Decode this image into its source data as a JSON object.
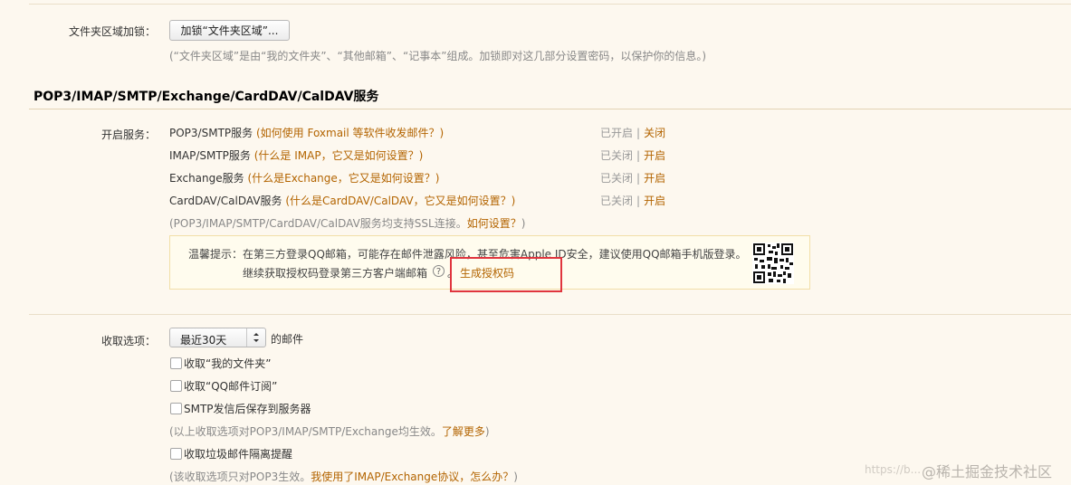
{
  "folder_lock": {
    "label": "文件夹区域加锁：",
    "button": "加锁“文件夹区域”...",
    "note": "(“文件夹区域”是由“我的文件夹”、“其他邮箱”、“记事本”组成。加锁即对这几部分设置密码，以保护你的信息。)"
  },
  "section": {
    "title": "POP3/IMAP/SMTP/Exchange/CardDAV/CalDAV服务"
  },
  "services": {
    "label": "开启服务：",
    "items": [
      {
        "name": "POP3/SMTP服务",
        "help": "(如何使用 Foxmail 等软件收发邮件？)",
        "status": "已开启",
        "sep": "|",
        "action": "关闭"
      },
      {
        "name": "IMAP/SMTP服务",
        "help": "(什么是 IMAP，它又是如何设置？)",
        "status": "已关闭",
        "sep": "|",
        "action": "开启"
      },
      {
        "name": "Exchange服务",
        "help": "(什么是Exchange，它又是如何设置？)",
        "status": "已关闭",
        "sep": "|",
        "action": "开启"
      },
      {
        "name": "CardDAV/CalDAV服务",
        "help": "(什么是CardDAV/CalDAV，它又是如何设置？)",
        "status": "已关闭",
        "sep": "|",
        "action": "开启"
      }
    ],
    "ssl_note": "(POP3/IMAP/SMTP/CardDAV/CalDAV服务均支持SSL连接。",
    "ssl_link": "如何设置？",
    "ssl_end": ")"
  },
  "tip": {
    "line1": "温馨提示：在第三方登录QQ邮箱，可能存在邮件泄露风险，甚至危害Apple ID安全，建议使用QQ邮箱手机版登录。",
    "line2": "继续获取授权码登录第三方客户端邮箱",
    "help": "?",
    "period": "。",
    "generate": "生成授权码"
  },
  "fetch": {
    "label": "收取选项：",
    "select_value": "最近30天",
    "select_suffix": "的邮件",
    "opt1": "收取“我的文件夹”",
    "opt2": "收取“QQ邮件订阅”",
    "opt3": "SMTP发信后保存到服务器",
    "note1": "(以上收取选项对POP3/IMAP/SMTP/Exchange均生效。",
    "note1_link": "了解更多",
    "note1_end": ")",
    "opt4": "收取垃圾邮件隔离提醒",
    "note2": "(该收取选项只对POP3生效。",
    "note2_link": "我使用了IMAP/Exchange协议，怎么办？",
    "note2_end": ")"
  },
  "watermark": {
    "url": "https://b...",
    "brand": "@稀土掘金技术社区"
  },
  "colors": {
    "link": "#b36400",
    "highlight": "#e0353e",
    "background": "#fdf8ef"
  }
}
